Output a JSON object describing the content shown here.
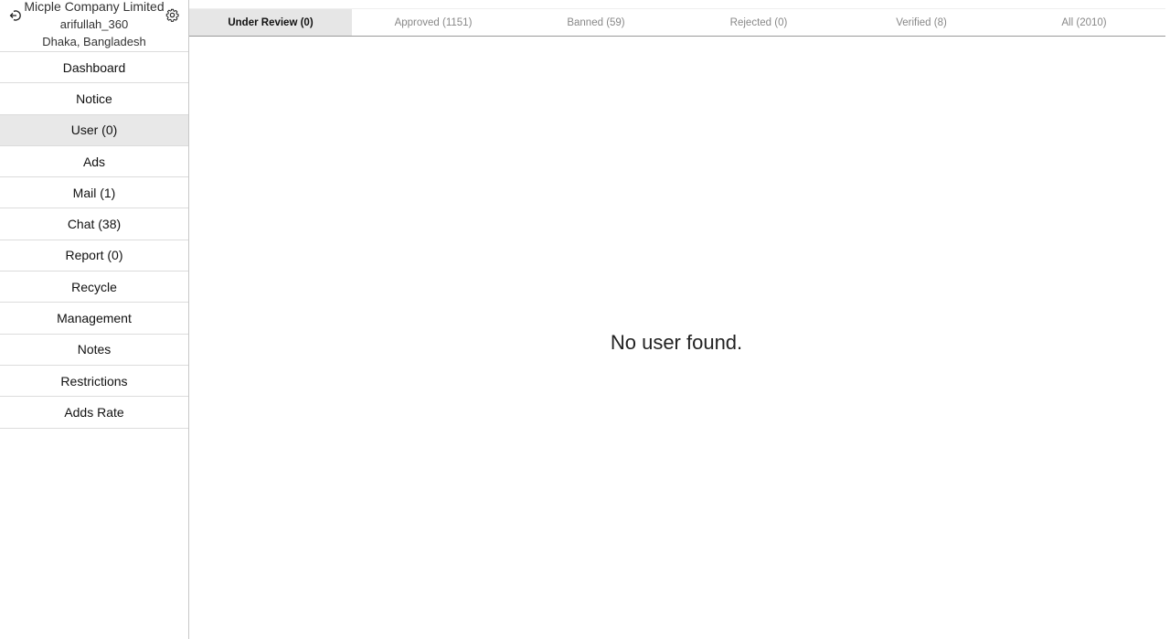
{
  "profile": {
    "company": "Micple Company Limited",
    "username": "arifullah_360",
    "location": "Dhaka, Bangladesh",
    "logout_icon": "logout-icon",
    "settings_icon": "gear-icon"
  },
  "sidebar": {
    "items": [
      {
        "label": "Dashboard"
      },
      {
        "label": "Notice"
      },
      {
        "label": "User (0)"
      },
      {
        "label": "Ads"
      },
      {
        "label": "Mail (1)"
      },
      {
        "label": "Chat (38)"
      },
      {
        "label": "Report (0)"
      },
      {
        "label": "Recycle"
      },
      {
        "label": "Management"
      },
      {
        "label": "Notes"
      },
      {
        "label": "Restrictions"
      },
      {
        "label": "Adds Rate"
      }
    ],
    "active": "User (0)"
  },
  "tabs": [
    {
      "label": "Under Review (0)"
    },
    {
      "label": "Approved (1151)"
    },
    {
      "label": "Banned (59)"
    },
    {
      "label": "Rejected (0)"
    },
    {
      "label": "Verified (8)"
    },
    {
      "label": "All (2010)"
    }
  ],
  "active_tab": "Under Review (0)",
  "main": {
    "empty_message": "No user found."
  },
  "colors": {
    "active_background": "#e8e8e8",
    "border": "#dcdcdc",
    "inactive_tab_text": "#888888"
  }
}
